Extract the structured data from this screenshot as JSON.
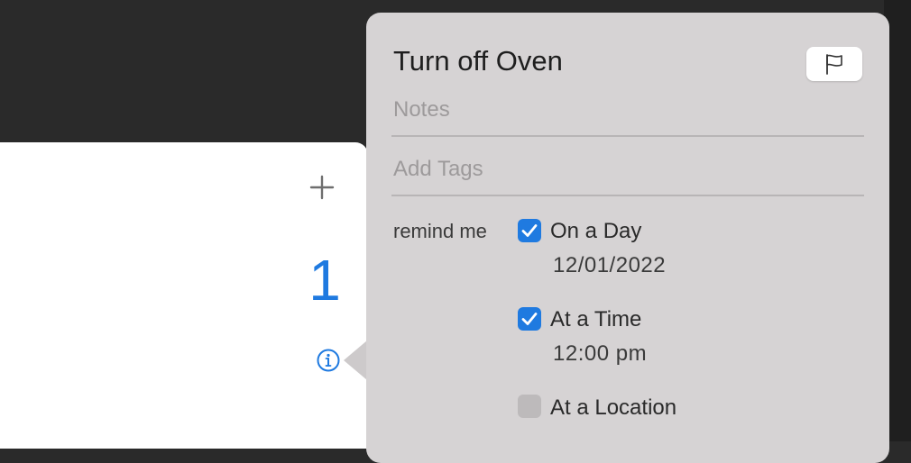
{
  "list": {
    "add_icon": "plus-icon",
    "count": "1",
    "info_icon": "info-icon",
    "accent_color": "#1f7ae0"
  },
  "popover": {
    "title": "Turn off Oven",
    "flag_icon": "flag-icon",
    "notes_placeholder": "Notes",
    "tags_placeholder": "Add Tags",
    "remind_label": "remind me",
    "options": [
      {
        "label": "On a Day",
        "checked": true,
        "value": "12/01/2022"
      },
      {
        "label": "At a Time",
        "checked": true,
        "value": "12:00 pm"
      },
      {
        "label": "At a Location",
        "checked": false
      }
    ]
  }
}
